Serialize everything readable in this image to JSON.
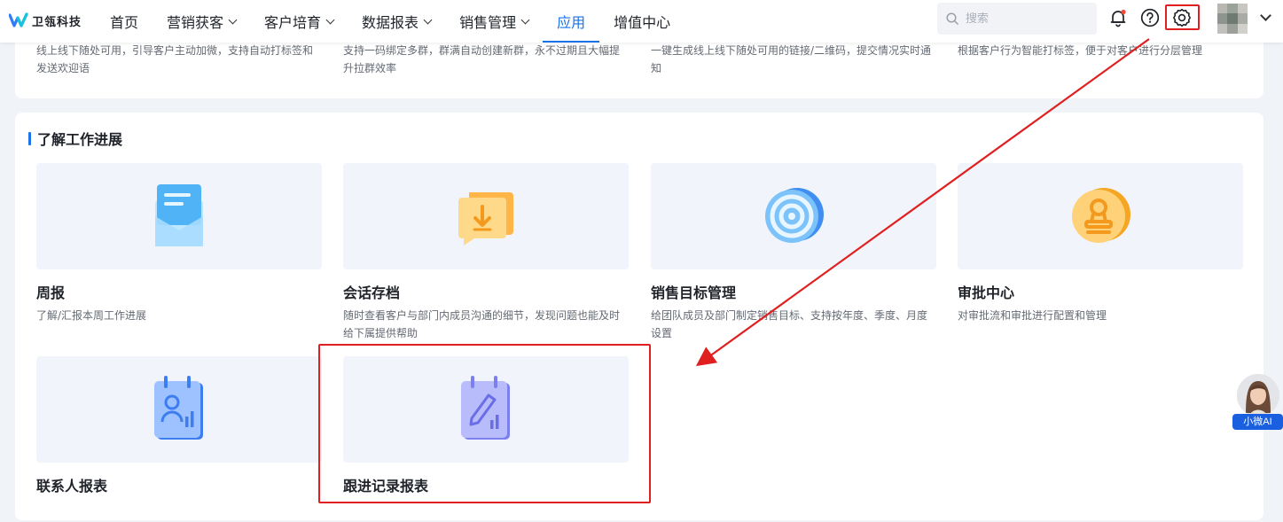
{
  "header": {
    "logo_text": "卫瓴科技",
    "nav": [
      {
        "label": "首页",
        "has_menu": false
      },
      {
        "label": "营销获客",
        "has_menu": true
      },
      {
        "label": "客户培育",
        "has_menu": true
      },
      {
        "label": "数据报表",
        "has_menu": true
      },
      {
        "label": "销售管理",
        "has_menu": true
      },
      {
        "label": "应用",
        "has_menu": false,
        "active": true
      },
      {
        "label": "增值中心",
        "has_menu": false
      }
    ],
    "search_placeholder": "搜索",
    "icons": [
      "bell-icon",
      "help-icon",
      "settings-icon",
      "chevron-down-icon"
    ]
  },
  "top_card": {
    "descriptions": [
      "线上线下随处可用，引导客户主动加微，支持自动打标签和发送欢迎语",
      "支持一码绑定多群，群满自动创建新群，永不过期且大幅提升拉群效率",
      "一键生成线上线下随处可用的链接/二维码，提交情况实时通知",
      "根据客户行为智能打标签，便于对客户进行分层管理"
    ]
  },
  "section": {
    "title": "了解工作进展",
    "apps": [
      {
        "name": "周报",
        "desc": "了解/汇报本周工作进展",
        "icon": "envelope-icon"
      },
      {
        "name": "会话存档",
        "desc": "随时查看客户与部门内成员沟通的细节，发现问题也能及时给下属提供帮助",
        "icon": "download-chat-icon"
      },
      {
        "name": "销售目标管理",
        "desc": "给团队成员及部门制定销售目标、支持按年度、季度、月度设置",
        "icon": "target-icon"
      },
      {
        "name": "审批中心",
        "desc": "对审批流和审批进行配置和管理",
        "icon": "stamp-icon"
      },
      {
        "name": "联系人报表",
        "desc": "",
        "icon": "contact-report-icon"
      },
      {
        "name": "跟进记录报表",
        "desc": "",
        "icon": "followup-report-icon"
      }
    ]
  },
  "ai_widget": {
    "label": "小微AI"
  },
  "colors": {
    "accent": "#1a73e8",
    "annotation": "#e02020"
  }
}
